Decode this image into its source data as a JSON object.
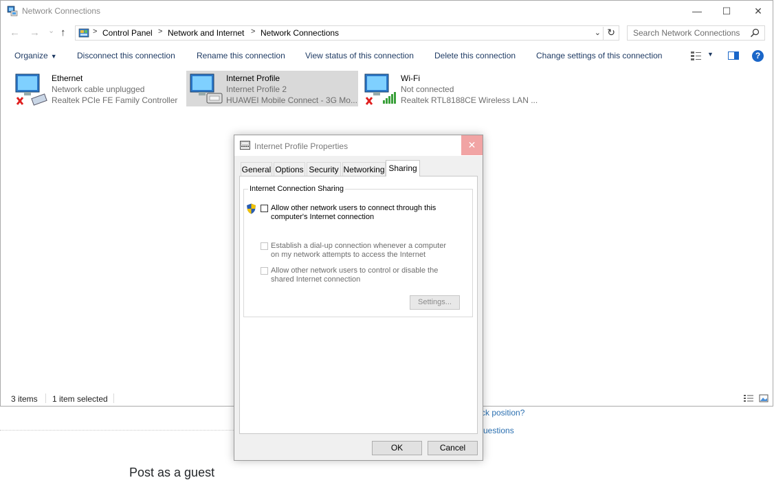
{
  "window": {
    "title": "Network Connections",
    "controls": {
      "minimize": "—",
      "maximize": "☐",
      "close": "✕"
    }
  },
  "nav": {
    "back": "←",
    "forward": "→",
    "recent": "⌄",
    "up": "↑",
    "breadcrumb": [
      "Control Panel",
      "Network and Internet",
      "Network Connections"
    ],
    "separator": ">",
    "dropdown": "⌄",
    "refresh": "↻",
    "search_placeholder": "Search Network Connections"
  },
  "commands": {
    "organize": "Organize",
    "caret": "▼",
    "disconnect": "Disconnect this connection",
    "rename": "Rename this connection",
    "view_status": "View status of this connection",
    "delete": "Delete this connection",
    "change_settings": "Change settings of this connection",
    "help": "?"
  },
  "connections": [
    {
      "name": "Ethernet",
      "status": "Network cable unplugged",
      "device": "Realtek PCIe FE Family Controller"
    },
    {
      "name": "Internet Profile",
      "status": "Internet Profile  2",
      "device": "HUAWEI Mobile Connect - 3G Mo..."
    },
    {
      "name": "Wi-Fi",
      "status": "Not connected",
      "device": "Realtek RTL8188CE Wireless LAN ..."
    }
  ],
  "statusbar": {
    "items_count": "3 items",
    "selected": "1 item selected"
  },
  "dialog": {
    "title": "Internet Profile Properties",
    "close": "✕",
    "tabs": [
      "General",
      "Options",
      "Security",
      "Networking",
      "Sharing"
    ],
    "active_tab": "Sharing",
    "group_label": "Internet Connection Sharing",
    "option_allow": "Allow other network users to connect through this computer's Internet connection",
    "option_dialup": "Establish a dial-up connection whenever a computer on my network attempts to access the Internet",
    "option_control": "Allow other network users to control or disable the shared Internet connection",
    "settings_button": "Settings...",
    "ok": "OK",
    "cancel": "Cancel"
  },
  "background_page": {
    "link1": "ck position?",
    "link2": "uestions",
    "heading": "Post as a guest"
  },
  "colors": {
    "accent": "#1a66c8",
    "command_text": "#1e3a63",
    "selection": "#d9d9d9",
    "close_hover": "#f1a4a4"
  }
}
